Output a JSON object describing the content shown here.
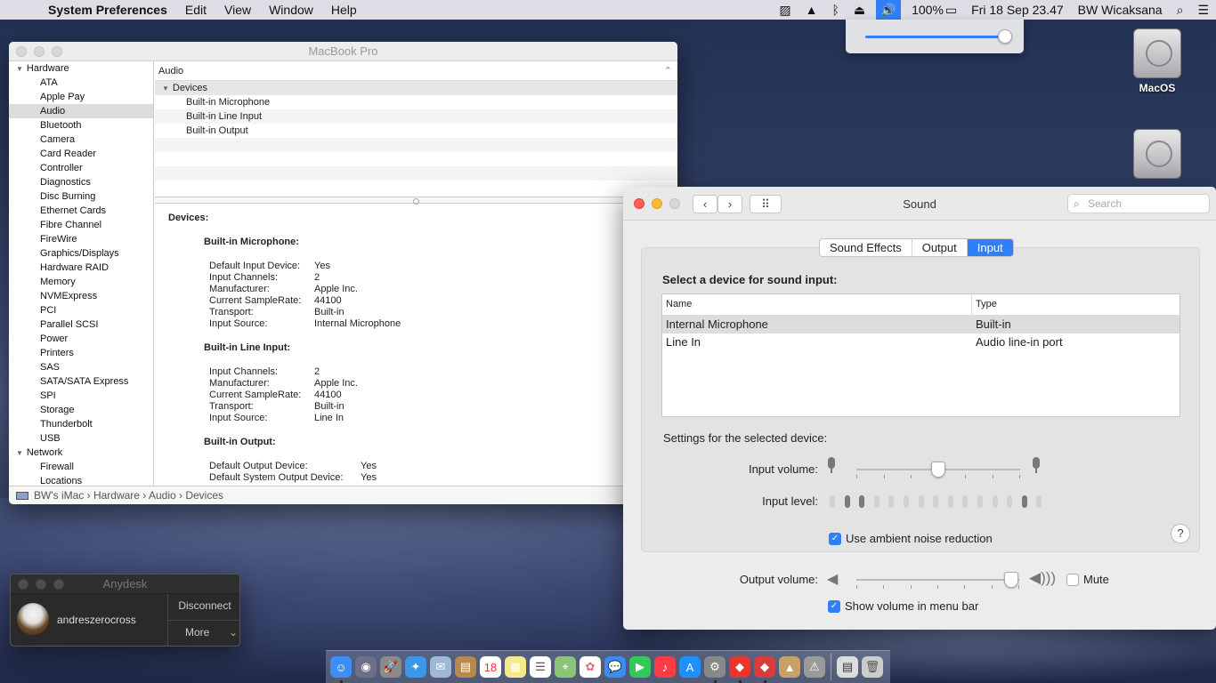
{
  "menubar": {
    "app_name": "System Preferences",
    "menus": [
      "Edit",
      "View",
      "Window",
      "Help"
    ],
    "battery": "100%",
    "datetime": "Fri 18 Sep  23.47",
    "user": "BW Wicaksana"
  },
  "desktop": {
    "disk1_label": "MacOS",
    "disk2_label": ""
  },
  "sysinfo": {
    "title": "MacBook Pro",
    "sidebar_hardware": "Hardware",
    "sidebar_items": [
      "ATA",
      "Apple Pay",
      "Audio",
      "Bluetooth",
      "Camera",
      "Card Reader",
      "Controller",
      "Diagnostics",
      "Disc Burning",
      "Ethernet Cards",
      "Fibre Channel",
      "FireWire",
      "Graphics/Displays",
      "Hardware RAID",
      "Memory",
      "NVMExpress",
      "PCI",
      "Parallel SCSI",
      "Power",
      "Printers",
      "SAS",
      "SATA/SATA Express",
      "SPI",
      "Storage",
      "Thunderbolt",
      "USB"
    ],
    "sidebar_network": "Network",
    "network_items": [
      "Firewall",
      "Locations"
    ],
    "list_header": "Audio",
    "devices_group": "Devices",
    "device_rows": [
      "Built-in Microphone",
      "Built-in Line Input",
      "Built-in Output"
    ],
    "detail": {
      "heading": "Devices:",
      "mic_title": "Built-in Microphone:",
      "mic": [
        [
          "Default Input Device:",
          "Yes"
        ],
        [
          "Input Channels:",
          "2"
        ],
        [
          "Manufacturer:",
          "Apple Inc."
        ],
        [
          "Current SampleRate:",
          "44100"
        ],
        [
          "Transport:",
          "Built-in"
        ],
        [
          "Input Source:",
          "Internal Microphone"
        ]
      ],
      "line_title": "Built-in Line Input:",
      "line": [
        [
          "Input Channels:",
          "2"
        ],
        [
          "Manufacturer:",
          "Apple Inc."
        ],
        [
          "Current SampleRate:",
          "44100"
        ],
        [
          "Transport:",
          "Built-in"
        ],
        [
          "Input Source:",
          "Line In"
        ]
      ],
      "out_title": "Built-in Output:",
      "out": [
        [
          "Default Output Device:",
          "Yes"
        ],
        [
          "Default System Output Device:",
          "Yes"
        ]
      ]
    },
    "path": [
      "BW's iMac",
      "Hardware",
      "Audio",
      "Devices"
    ]
  },
  "sound": {
    "title": "Sound",
    "search_placeholder": "Search",
    "tabs": [
      "Sound Effects",
      "Output",
      "Input"
    ],
    "active_tab": "Input",
    "select_label": "Select a device for sound input:",
    "col_name": "Name",
    "col_type": "Type",
    "devices": [
      {
        "name": "Internal Microphone",
        "type": "Built-in"
      },
      {
        "name": "Line In",
        "type": "Audio line-in port"
      }
    ],
    "settings_label": "Settings for the selected device:",
    "input_volume_label": "Input volume:",
    "input_volume": 0.5,
    "input_level_label": "Input level:",
    "input_level_segments_on": [
      1,
      2,
      13
    ],
    "input_level_segment_count": 15,
    "ambient_label": "Use ambient noise reduction",
    "ambient_checked": true,
    "help": "?",
    "output_volume_label": "Output volume:",
    "output_volume": 0.95,
    "mute_label": "Mute",
    "mute_checked": false,
    "show_volume_label": "Show volume in menu bar",
    "show_volume_checked": true
  },
  "menubar_volume_popup_level": 0.98,
  "anydesk": {
    "title": "Anydesk",
    "user": "andreszerocross",
    "disconnect": "Disconnect",
    "more": "More"
  },
  "colors": {
    "accent": "#2f7ff7"
  }
}
